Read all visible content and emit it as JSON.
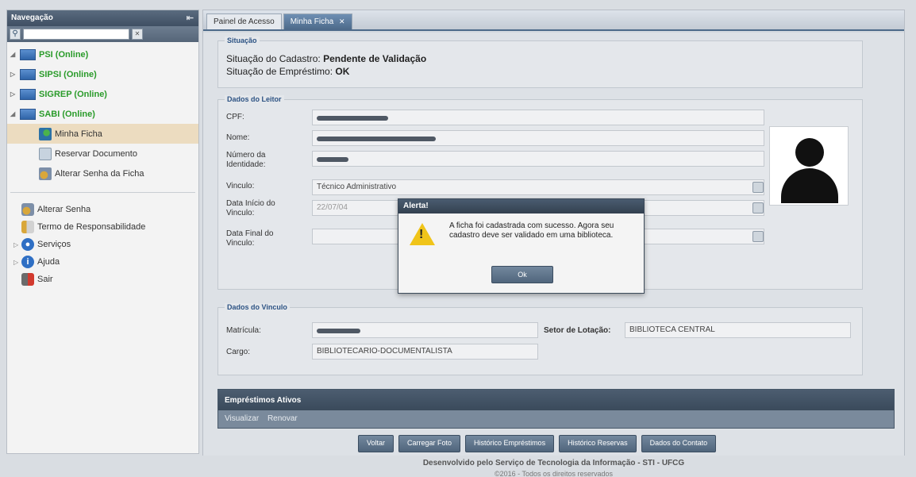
{
  "sidebar": {
    "title": "Navegação",
    "systems": [
      {
        "label": "PSI (Online)",
        "expander": "◢"
      },
      {
        "label": "SIPSI (Online)",
        "expander": "▷"
      },
      {
        "label": "SIGREP (Online)",
        "expander": "▷"
      },
      {
        "label": "SABI (Online)",
        "expander": "◢"
      }
    ],
    "sabi_children": [
      {
        "label": "Minha Ficha"
      },
      {
        "label": "Reservar Documento"
      },
      {
        "label": "Alterar Senha da Ficha"
      }
    ],
    "menu": [
      {
        "label": "Alterar Senha",
        "icon": "key-user-icon"
      },
      {
        "label": "Termo de Responsabilidade",
        "icon": "document-pen-icon"
      },
      {
        "label": "Serviços",
        "icon": "services-icon"
      },
      {
        "label": "Ajuda",
        "icon": "help-icon"
      },
      {
        "label": "Sair",
        "icon": "exit-icon"
      }
    ]
  },
  "tabs": [
    {
      "label": "Painel de Acesso"
    },
    {
      "label": "Minha Ficha"
    }
  ],
  "situacao": {
    "legend": "Situação",
    "cadastro_label": "Situação do Cadastro:",
    "cadastro_value": "Pendente de Validação",
    "emprestimo_label": "Situação de Empréstimo:",
    "emprestimo_value": "OK"
  },
  "leitor": {
    "legend": "Dados do Leitor",
    "cpf_label": "CPF:",
    "nome_label": "Nome:",
    "identidade_label": "Número da Identidade:",
    "vinculo_label": "Vinculo:",
    "vinculo_value": "Técnico Administrativo",
    "data_inicio_label": "Data Início do Vinculo:",
    "data_inicio_value": "22/07/04",
    "data_final_label": "Data Final do Vinculo:",
    "data_final_value": ""
  },
  "vinculo": {
    "legend": "Dados do Vinculo",
    "matricula_label": "Matrícula:",
    "setor_label": "Setor de Lotação:",
    "setor_value": "BIBLIOTECA CENTRAL",
    "cargo_label": "Cargo:",
    "cargo_value": "BIBLIOTECARIO-DOCUMENTALISTA"
  },
  "emprestimos": {
    "title": "Empréstimos Ativos",
    "actions": [
      "Visualizar",
      "Renovar"
    ]
  },
  "buttons": [
    "Voltar",
    "Carregar Foto",
    "Histórico Empréstimos",
    "Histórico Reservas",
    "Dados do Contato"
  ],
  "dialog": {
    "title": "Alerta!",
    "message": "A ficha foi cadastrada com sucesso. Agora seu cadastro deve ser validado em uma biblioteca.",
    "ok": "Ok"
  },
  "footer": {
    "line1": "Desenvolvido pelo Serviço de Tecnologia da Informação - STI - UFCG",
    "line2": "©2016 - Todos os direitos reservados"
  }
}
